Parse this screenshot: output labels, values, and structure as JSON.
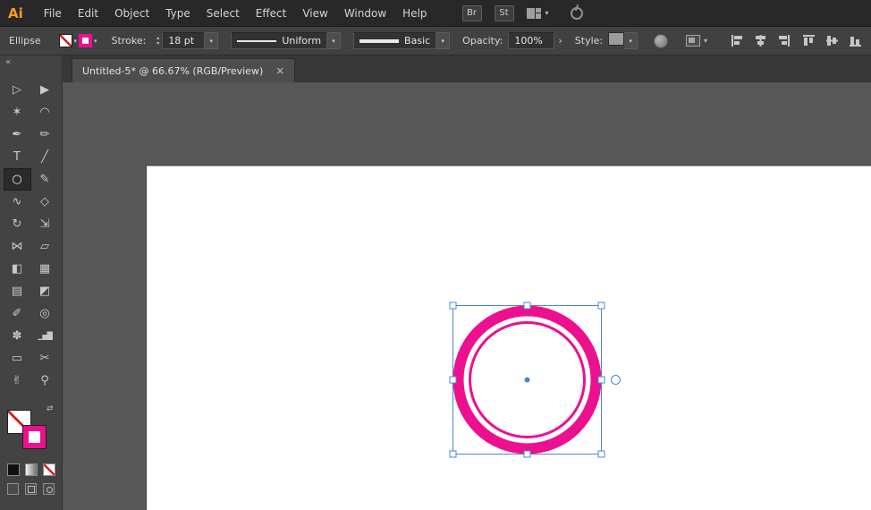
{
  "menubar": {
    "logo": "Ai",
    "items": [
      "File",
      "Edit",
      "Object",
      "Type",
      "Select",
      "Effect",
      "View",
      "Window",
      "Help"
    ],
    "bridge_label": "Br",
    "stock_label": "St"
  },
  "control_bar": {
    "tool_name": "Ellipse",
    "stroke_label": "Stroke:",
    "stroke_weight": "18 pt",
    "width_profile": "Uniform",
    "brush_style": "Basic",
    "opacity_label": "Opacity:",
    "opacity_value": "100%",
    "style_label": "Style:"
  },
  "document_tab": {
    "title": "Untitled-5* @ 66.67% (RGB/Preview)",
    "close_glyph": "×"
  },
  "icons": {
    "chevron_down": "▾",
    "chevron_up": "▴",
    "popout_arrow": "›",
    "collapse_panel": "«",
    "swap_colors": "⇄"
  },
  "toolbar": {
    "tools": [
      {
        "name": "selection",
        "glyph": "▷"
      },
      {
        "name": "direct-selection",
        "glyph": "▶"
      },
      {
        "name": "magic-wand",
        "glyph": "✶"
      },
      {
        "name": "lasso",
        "glyph": "◠"
      },
      {
        "name": "pen",
        "glyph": "✒"
      },
      {
        "name": "curvature",
        "glyph": "✏"
      },
      {
        "name": "type",
        "glyph": "T"
      },
      {
        "name": "line-segment",
        "glyph": "╱"
      },
      {
        "name": "ellipse",
        "glyph": "○",
        "selected": true
      },
      {
        "name": "paintbrush",
        "glyph": "✎"
      },
      {
        "name": "shaper",
        "glyph": "∿"
      },
      {
        "name": "eraser",
        "glyph": "◇"
      },
      {
        "name": "rotate",
        "glyph": "↻"
      },
      {
        "name": "scale",
        "glyph": "⇲"
      },
      {
        "name": "width",
        "glyph": "⋈"
      },
      {
        "name": "free-transform",
        "glyph": "▱"
      },
      {
        "name": "shape-builder",
        "glyph": "◧"
      },
      {
        "name": "perspective-grid",
        "glyph": "▦"
      },
      {
        "name": "mesh",
        "glyph": "▤"
      },
      {
        "name": "gradient",
        "glyph": "◩"
      },
      {
        "name": "eyedropper",
        "glyph": "✐"
      },
      {
        "name": "blend",
        "glyph": "◎"
      },
      {
        "name": "symbol-sprayer",
        "glyph": "✽"
      },
      {
        "name": "column-graph",
        "glyph": "▁▅█"
      },
      {
        "name": "artboard",
        "glyph": "▭"
      },
      {
        "name": "slice",
        "glyph": "✂"
      },
      {
        "name": "hand",
        "glyph": "✌"
      },
      {
        "name": "zoom",
        "glyph": "⚲"
      }
    ]
  },
  "colors": {
    "accent_pink": "#ec108f",
    "selection_blue": "#4a86d8",
    "canvas_background": "#575757",
    "artboard_white": "#ffffff"
  }
}
